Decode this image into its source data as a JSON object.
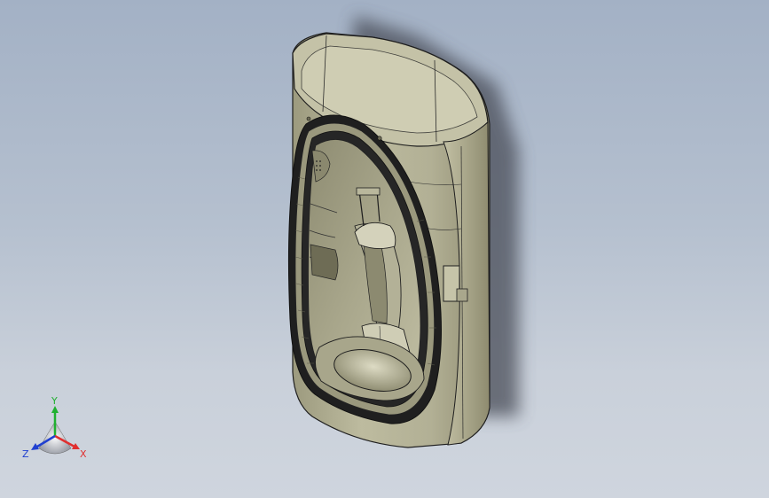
{
  "model_view": {
    "part": "cad-housing-part",
    "colors": {
      "background_top": "#a3b1c5",
      "background_bottom": "#cfd5de",
      "body": "#b4b296",
      "body_shade": "#908d70",
      "edge": "#1e1e1e",
      "shadow": "#4a4d58"
    }
  },
  "triad": {
    "y_label": "Y",
    "x_label": "X",
    "z_label": "Z",
    "colors": {
      "x": "#e03030",
      "y": "#20b030",
      "z": "#2040d0"
    }
  }
}
